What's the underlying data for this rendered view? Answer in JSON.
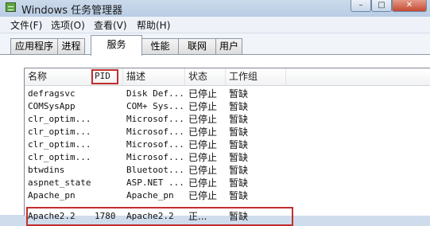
{
  "window": {
    "title": "Windows 任务管理器",
    "buttons": [
      "–",
      "□",
      "✕"
    ]
  },
  "menu": [
    {
      "label": "文件(F)"
    },
    {
      "label": "选项(O)"
    },
    {
      "label": "查看(V)"
    },
    {
      "label": "帮助(H)"
    }
  ],
  "tabs": [
    {
      "label": "应用程序"
    },
    {
      "label": "进程"
    },
    {
      "label": "服务",
      "active": true
    },
    {
      "label": "性能"
    },
    {
      "label": "联网"
    },
    {
      "label": "用户"
    }
  ],
  "services": {
    "columns": [
      "名称",
      "PID",
      "描述",
      "状态",
      "工作组"
    ],
    "rows": [
      {
        "name": "defragsvc",
        "pid": "",
        "desc": "Disk Def...",
        "status": "已停止",
        "group": "暂缺"
      },
      {
        "name": "COMSysApp",
        "pid": "",
        "desc": "COM+ Sys...",
        "status": "已停止",
        "group": "暂缺"
      },
      {
        "name": "clr_optim...",
        "pid": "",
        "desc": "Microsof...",
        "status": "已停止",
        "group": "暂缺"
      },
      {
        "name": "clr_optim...",
        "pid": "",
        "desc": "Microsof...",
        "status": "已停止",
        "group": "暂缺"
      },
      {
        "name": "clr_optim...",
        "pid": "",
        "desc": "Microsof...",
        "status": "已停止",
        "group": "暂缺"
      },
      {
        "name": "clr_optim...",
        "pid": "",
        "desc": "Microsof...",
        "status": "已停止",
        "group": "暂缺"
      },
      {
        "name": "btwdins",
        "pid": "",
        "desc": "Bluetoot...",
        "status": "已停止",
        "group": "暂缺"
      },
      {
        "name": "aspnet_state",
        "pid": "",
        "desc": "ASP.NET ...",
        "status": "已停止",
        "group": "暂缺"
      },
      {
        "name": "Apache_pn",
        "pid": "",
        "desc": "Apache_pn",
        "status": "已停止",
        "group": "暂缺"
      },
      {
        "name": "Apache2.2",
        "pid": "1780",
        "desc": "Apache2.2",
        "status": "正...",
        "group": "暂缺"
      }
    ]
  }
}
